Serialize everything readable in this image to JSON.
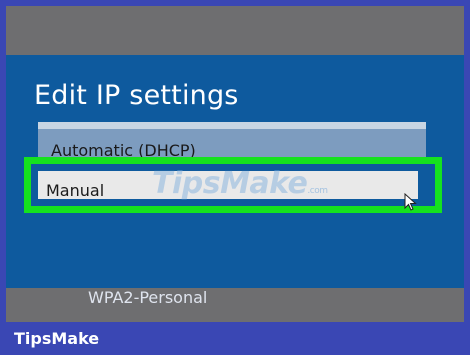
{
  "dialog": {
    "title": "Edit IP settings",
    "dropdown": {
      "options": [
        "Automatic (DHCP)",
        "Manual"
      ],
      "selected": "Manual",
      "icons": {
        "pointer": "mouse-pointer-icon"
      }
    },
    "highlight_color": "#15e21f"
  },
  "background_list": {
    "security_type": "WPA2-Personal",
    "partial_next": "- - - -"
  },
  "watermark": {
    "text": "TipsMake",
    "suffix": ".com"
  },
  "footer": {
    "brand": "TipsMake"
  },
  "colors": {
    "frame": "#3a47b4",
    "dialog_bg": "#0e5a9e",
    "gray_band": "#6e6e70",
    "dropdown_bg": "#7d9cbf",
    "selected_row": "#e9e9e9"
  }
}
